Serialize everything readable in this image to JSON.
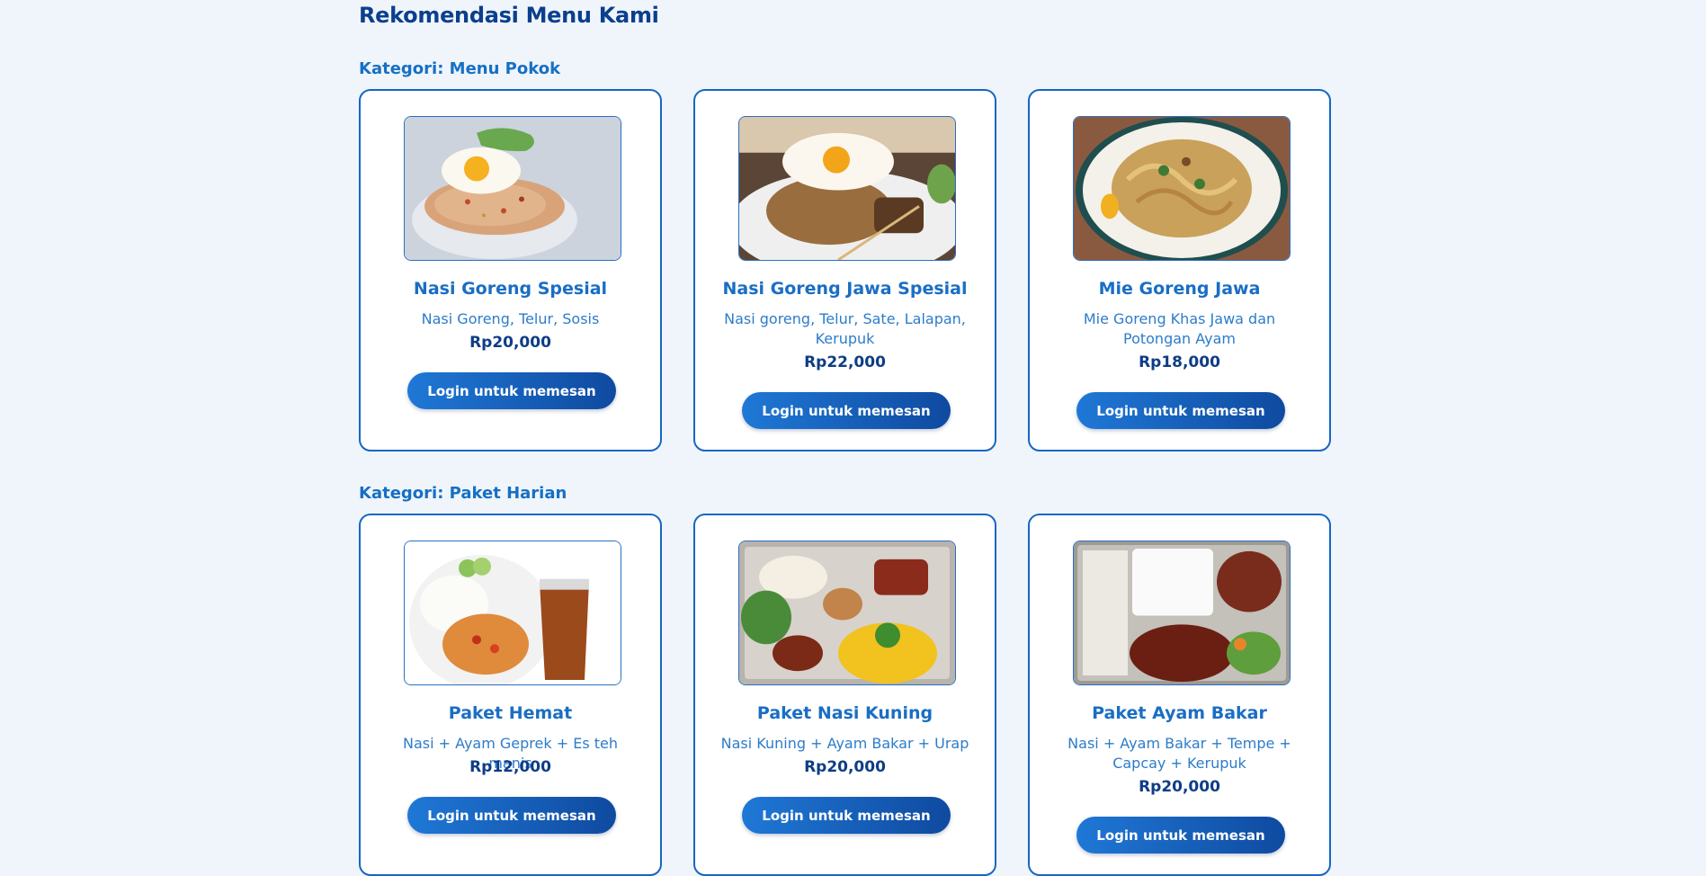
{
  "page": {
    "title": "Rekomendasi Menu Kami"
  },
  "categories": [
    {
      "label": "Kategori: Menu Pokok",
      "items": [
        {
          "name": "Nasi Goreng Spesial",
          "desc": "Nasi Goreng, Telur, Sosis",
          "price": "Rp20,000",
          "button": "Login untuk memesan",
          "image_alt": "fried-rice-with-egg-photo"
        },
        {
          "name": "Nasi Goreng Jawa Spesial",
          "desc": "Nasi goreng, Telur, Sate, Lalapan, Kerupuk",
          "price": "Rp22,000",
          "button": "Login untuk memesan",
          "image_alt": "javanese-fried-rice-photo"
        },
        {
          "name": "Mie Goreng Jawa",
          "desc": "Mie Goreng Khas Jawa dan Potongan Ayam",
          "price": "Rp18,000",
          "button": "Login untuk memesan",
          "image_alt": "javanese-fried-noodles-photo"
        }
      ]
    },
    {
      "label": "Kategori: Paket Harian",
      "items": [
        {
          "name": "Paket Hemat",
          "desc": "Nasi + Ayam Geprek + Es teh manis",
          "price": "Rp12,000",
          "button": "Login untuk memesan",
          "image_alt": "rice-geprek-chicken-iced-tea-photo"
        },
        {
          "name": "Paket Nasi Kuning",
          "desc": "Nasi Kuning + Ayam Bakar + Urap",
          "price": "Rp20,000",
          "button": "Login untuk memesan",
          "image_alt": "yellow-rice-box-photo"
        },
        {
          "name": "Paket Ayam Bakar",
          "desc": "Nasi + Ayam Bakar + Tempe + Capcay + Kerupuk",
          "price": "Rp20,000",
          "button": "Login untuk memesan",
          "image_alt": "grilled-chicken-box-photo"
        }
      ]
    }
  ],
  "colors": {
    "background": "#f0f5fb",
    "card_border": "#1766c2",
    "heading": "#0b3f8e",
    "accent": "#1a6ec4",
    "button": "#1f78d6"
  }
}
